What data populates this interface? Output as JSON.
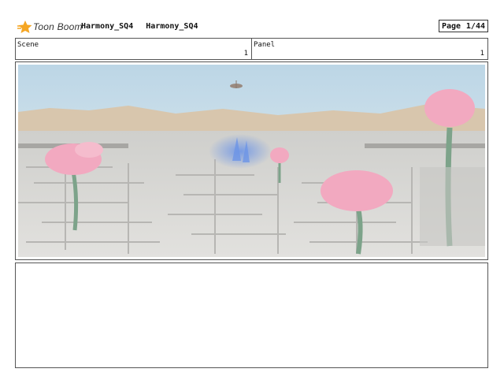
{
  "header": {
    "brand": "Toon Boom",
    "project": "Harmony_SQ4",
    "sequence": "Harmony_SQ4",
    "page_label": "Page",
    "page_number": "1/44"
  },
  "info": {
    "scene_label": "Scene",
    "scene_value": "1",
    "panel_label": "Panel",
    "panel_value": "1"
  },
  "colors": {
    "sky": "#c9dde8",
    "blossom": "#f2a9c0",
    "maze": "#d9d8d6",
    "portal": "#6d95e6"
  }
}
